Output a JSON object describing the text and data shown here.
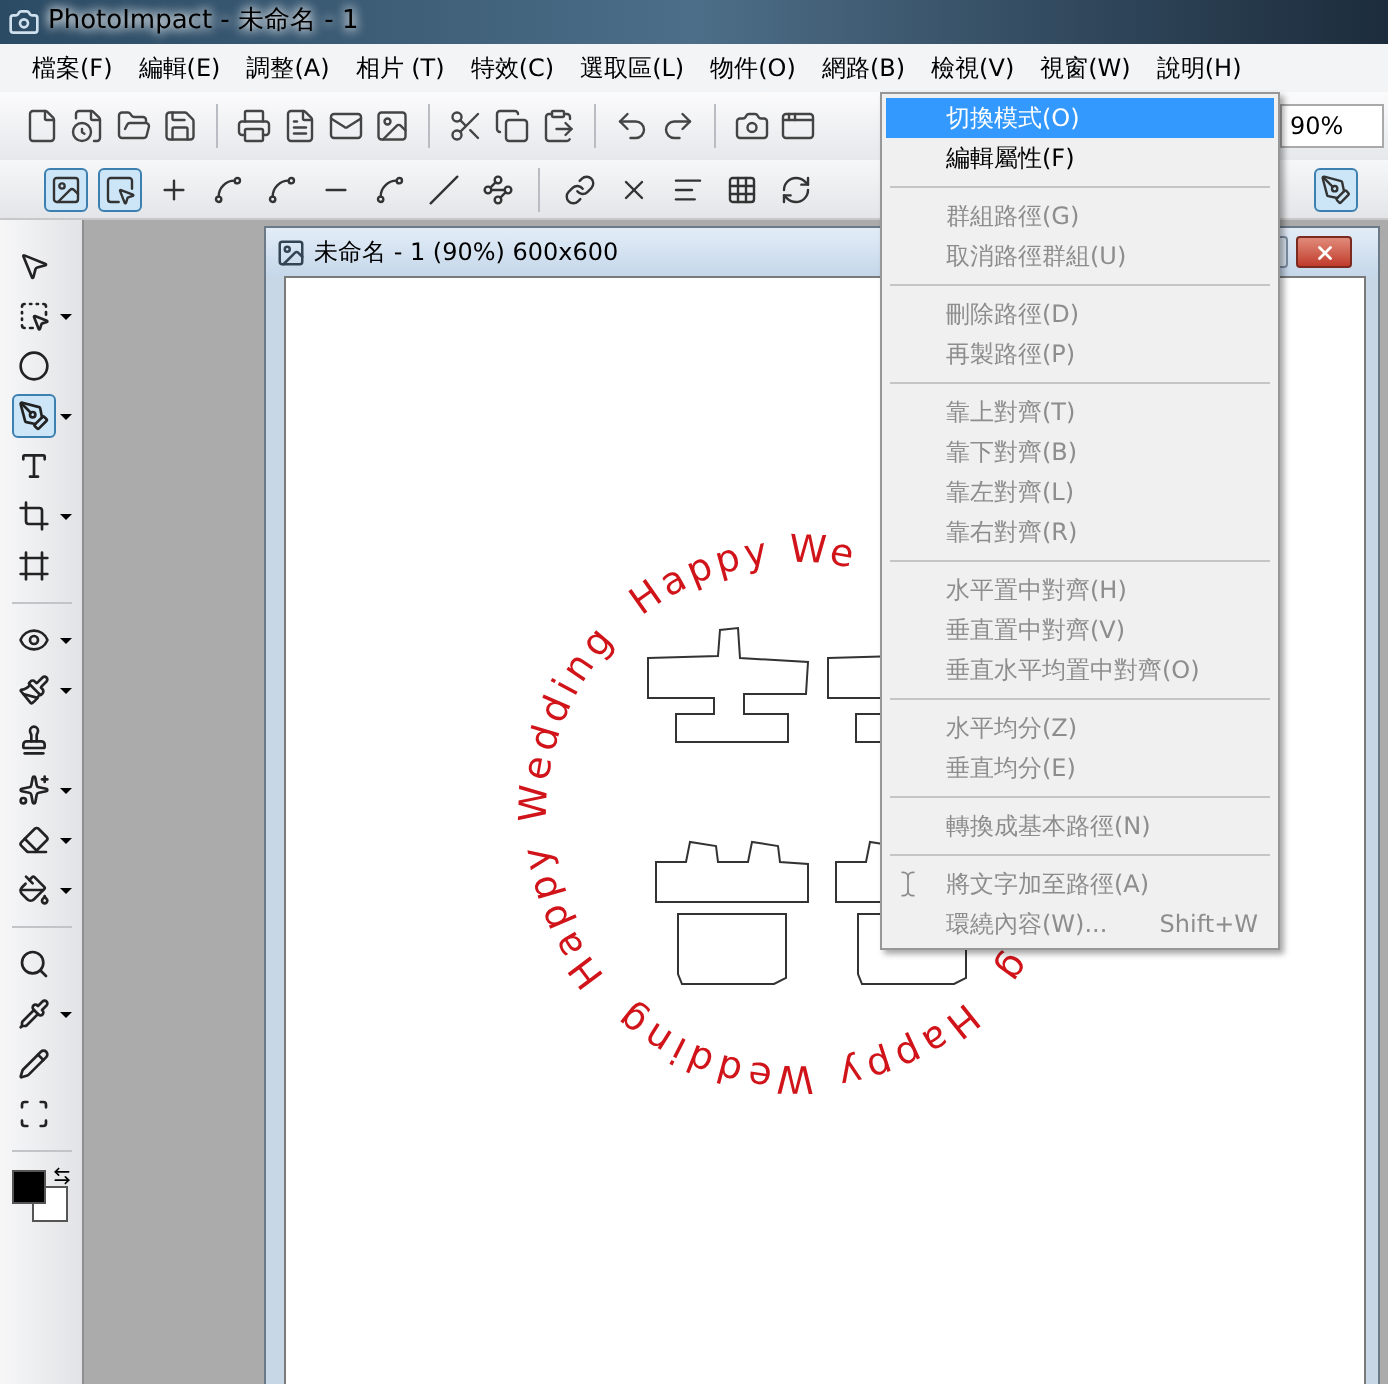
{
  "window": {
    "title": "PhotoImpact - 未命名 - 1"
  },
  "menu_bar": [
    "檔案(F)",
    "編輯(E)",
    "調整(A)",
    "相片 (T)",
    "特效(C)",
    "選取區(L)",
    "物件(O)",
    "網路(B)",
    "檢視(V)",
    "視窗(W)",
    "說明(H)"
  ],
  "toolbar": {
    "zoom": "90%"
  },
  "path_toolbar": [
    {
      "selected": true
    },
    {
      "selected": true
    },
    {
      "selected": false
    },
    {
      "selected": false
    },
    {
      "selected": false
    },
    {
      "selected": false
    },
    {
      "selected": false
    },
    {
      "selected": false
    },
    {
      "selected": false
    },
    {
      "selected": false
    },
    {
      "selected": false
    },
    {
      "selected": false
    },
    {
      "selected": false
    },
    {
      "selected": false
    },
    {
      "selected": true
    }
  ],
  "toolbox": {
    "tools": [
      {
        "selected": false,
        "flyout": false
      },
      {
        "selected": false,
        "flyout": true
      },
      {
        "selected": false,
        "flyout": false
      },
      {
        "selected": true,
        "flyout": true
      },
      {
        "selected": false,
        "flyout": false
      },
      {
        "selected": false,
        "flyout": true
      },
      {
        "selected": false,
        "flyout": false
      },
      {
        "selected": false,
        "flyout": true
      },
      {
        "selected": false,
        "flyout": true
      },
      {
        "selected": false,
        "flyout": false
      },
      {
        "selected": false,
        "flyout": true
      },
      {
        "selected": false,
        "flyout": true
      },
      {
        "selected": false,
        "flyout": true
      },
      {
        "selected": false,
        "flyout": false
      },
      {
        "selected": false,
        "flyout": true
      },
      {
        "selected": false,
        "flyout": false
      },
      {
        "selected": false,
        "flyout": false
      }
    ]
  },
  "document": {
    "title": "未命名 - 1 (90%) 600x600",
    "canvas": {
      "text_on_path": [
        "g",
        "Happy Wedding",
        "Happy Wedding",
        "Happy We"
      ]
    }
  },
  "context_menu": {
    "items": [
      {
        "kind": "item",
        "label": "切換模式(O)",
        "selected": true,
        "disabled": false
      },
      {
        "kind": "item",
        "label": "編輯屬性(F)",
        "selected": false,
        "disabled": false
      },
      {
        "kind": "separator"
      },
      {
        "kind": "item",
        "label": "群組路徑(G)",
        "selected": false,
        "disabled": true
      },
      {
        "kind": "item",
        "label": "取消路徑群組(U)",
        "selected": false,
        "disabled": true
      },
      {
        "kind": "separator"
      },
      {
        "kind": "item",
        "label": "刪除路徑(D)",
        "selected": false,
        "disabled": true
      },
      {
        "kind": "item",
        "label": "再製路徑(P)",
        "selected": false,
        "disabled": true
      },
      {
        "kind": "separator"
      },
      {
        "kind": "item",
        "label": "靠上對齊(T)",
        "selected": false,
        "disabled": true
      },
      {
        "kind": "item",
        "label": "靠下對齊(B)",
        "selected": false,
        "disabled": true
      },
      {
        "kind": "item",
        "label": "靠左對齊(L)",
        "selected": false,
        "disabled": true
      },
      {
        "kind": "item",
        "label": "靠右對齊(R)",
        "selected": false,
        "disabled": true
      },
      {
        "kind": "separator"
      },
      {
        "kind": "item",
        "label": "水平置中對齊(H)",
        "selected": false,
        "disabled": true
      },
      {
        "kind": "item",
        "label": "垂直置中對齊(V)",
        "selected": false,
        "disabled": true
      },
      {
        "kind": "item",
        "label": "垂直水平均置中對齊(O)",
        "selected": false,
        "disabled": true
      },
      {
        "kind": "separator"
      },
      {
        "kind": "item",
        "label": "水平均分(Z)",
        "selected": false,
        "disabled": true
      },
      {
        "kind": "item",
        "label": "垂直均分(E)",
        "selected": false,
        "disabled": true
      },
      {
        "kind": "separator"
      },
      {
        "kind": "item",
        "label": "轉換成基本路徑(N)",
        "selected": false,
        "disabled": true
      },
      {
        "kind": "separator"
      },
      {
        "kind": "item",
        "label": "將文字加至路徑(A)",
        "selected": false,
        "disabled": true,
        "icon": true
      },
      {
        "kind": "item",
        "label": "環繞內容(W)...",
        "selected": false,
        "disabled": true,
        "shortcut": "Shift+W"
      }
    ]
  }
}
